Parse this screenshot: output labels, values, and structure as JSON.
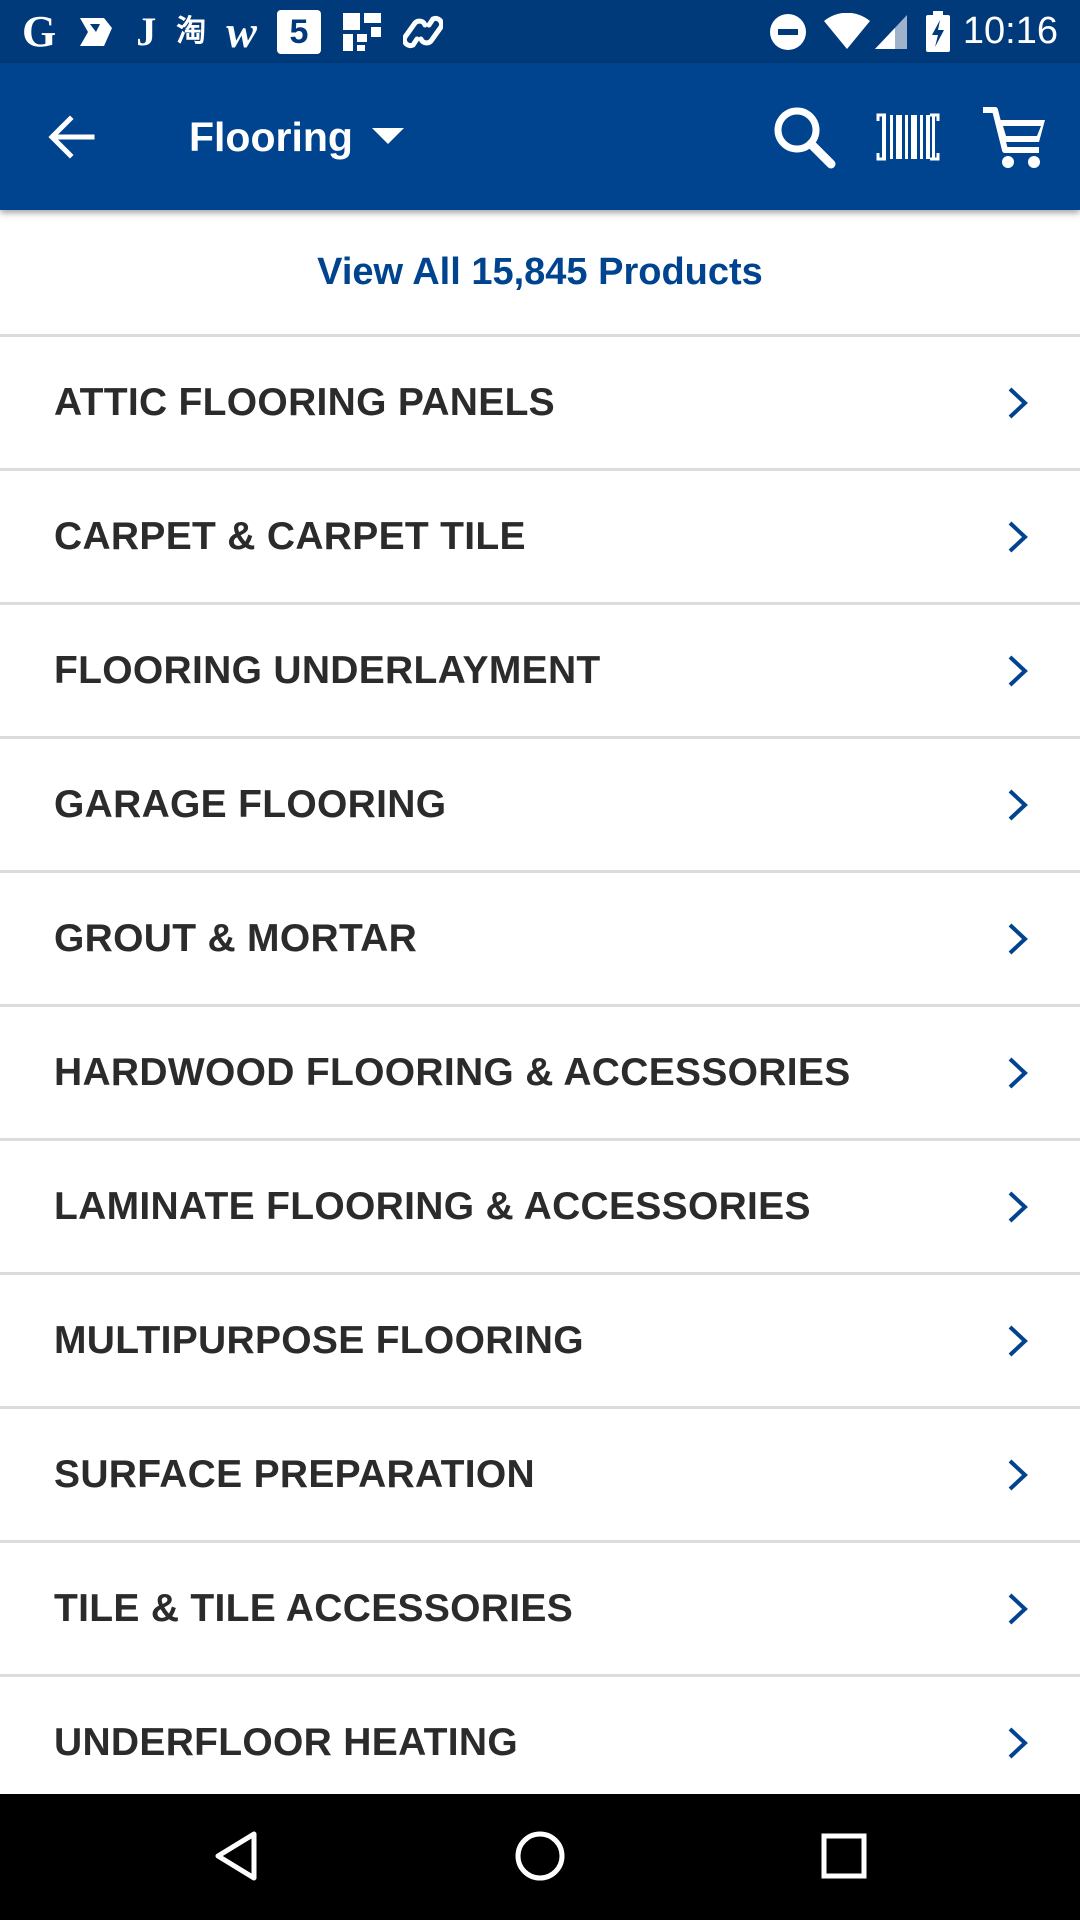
{
  "status_bar": {
    "left_icons": [
      "google-icon",
      "drive-icon",
      "j-icon",
      "taobao-icon",
      "w-icon",
      "five-icon",
      "grid-app-icon",
      "link-icon"
    ],
    "taobao_glyph": "淘",
    "j_glyph": "J",
    "g_glyph": "G",
    "w_glyph": "w",
    "five_glyph": "5",
    "right_icons": [
      "do-not-disturb-icon",
      "wifi-icon",
      "signal-icon",
      "battery-charging-icon"
    ],
    "time": "10:16"
  },
  "app_bar": {
    "title": "Flooring",
    "colors": {
      "background": "#00448f",
      "status_bar": "#003a7a"
    }
  },
  "view_all": {
    "label": "View All 15,845 Products",
    "color": "#00448f"
  },
  "categories": [
    {
      "label": "ATTIC FLOORING PANELS"
    },
    {
      "label": "CARPET & CARPET TILE"
    },
    {
      "label": "FLOORING UNDERLAYMENT"
    },
    {
      "label": "GARAGE FLOORING"
    },
    {
      "label": "GROUT & MORTAR"
    },
    {
      "label": "HARDWOOD FLOORING & ACCESSORIES"
    },
    {
      "label": "LAMINATE FLOORING & ACCESSORIES"
    },
    {
      "label": "MULTIPURPOSE FLOORING"
    },
    {
      "label": "SURFACE PREPARATION"
    },
    {
      "label": "TILE & TILE ACCESSORIES"
    },
    {
      "label": "UNDERFLOOR HEATING"
    }
  ],
  "nav_bar": {
    "icons": [
      "nav-back-icon",
      "nav-home-icon",
      "nav-recent-apps-icon"
    ]
  }
}
